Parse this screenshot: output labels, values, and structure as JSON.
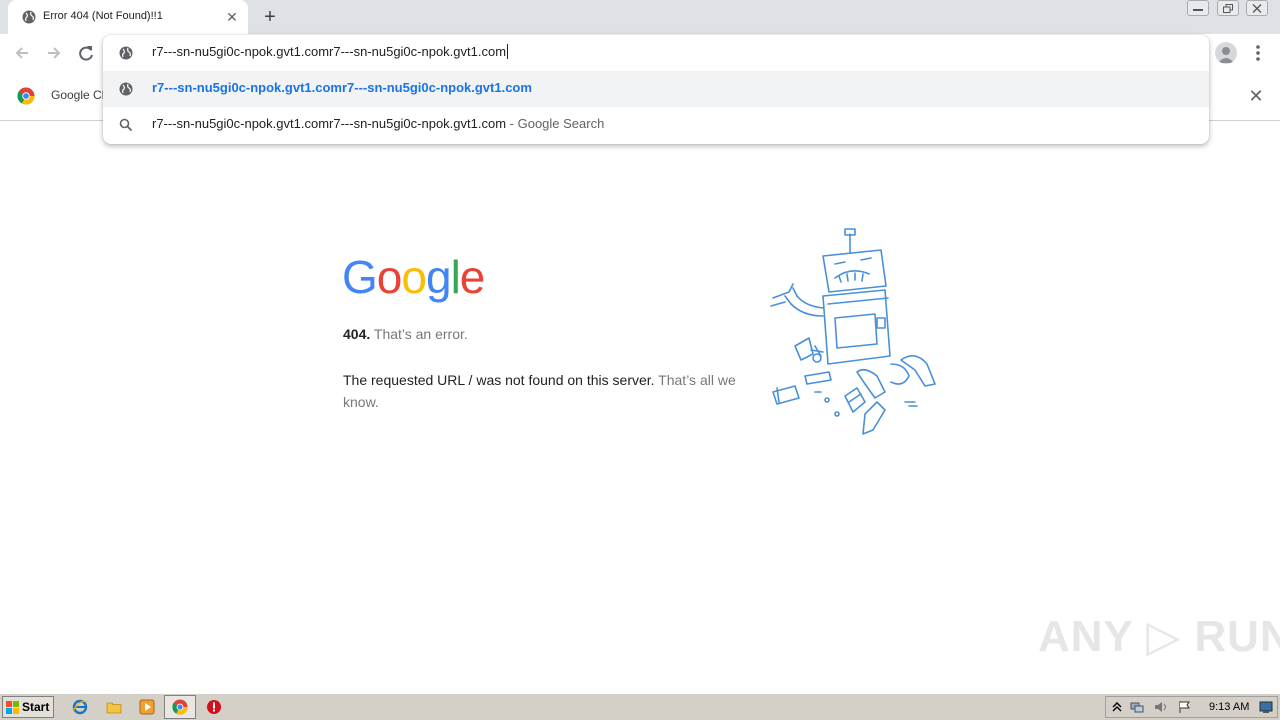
{
  "tab": {
    "title": "Error 404 (Not Found)!!1",
    "close_glyph": "✕",
    "new_tab_glyph": "+"
  },
  "omnibox": {
    "input_value": "r7---sn-nu5gi0c-npok.gvt1.comr7---sn-nu5gi0c-npok.gvt1.com",
    "suggestions": [
      {
        "icon": "globe-icon",
        "text": "r7---sn-nu5gi0c-npok.gvt1.comr7---sn-nu5gi0c-npok.gvt1.com",
        "suffix": ""
      },
      {
        "icon": "search-icon",
        "text": "r7---sn-nu5gi0c-npok.gvt1.comr7---sn-nu5gi0c-npok.gvt1.com",
        "suffix": " - Google Search"
      }
    ]
  },
  "bookmarks": {
    "item_label": "Google Cl",
    "close_glyph": "✕"
  },
  "page": {
    "logo_letters": [
      "G",
      "o",
      "o",
      "g",
      "l",
      "e"
    ],
    "logo_colors": [
      "#4285F4",
      "#EA4335",
      "#FBBC05",
      "#4285F4",
      "#34A853",
      "#EA4335"
    ],
    "error_code": "404.",
    "error_title": " That’s an error.",
    "message_main": "The requested URL / was not found on this server.",
    "message_soft": " That’s all we know."
  },
  "watermark": "ANY ▷ RUN",
  "taskbar": {
    "start_label": "Start",
    "clock": "9:13 AM"
  },
  "colors": {
    "accent": "#1a73e8",
    "tabstrip": "#dee1e6",
    "taskbar": "#d4d0c8"
  }
}
